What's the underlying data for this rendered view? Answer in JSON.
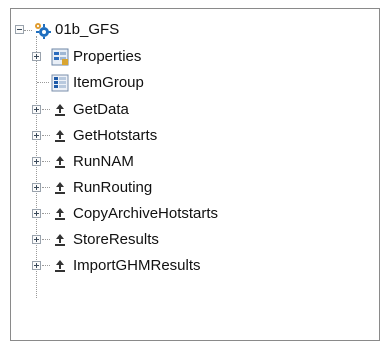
{
  "tree": {
    "root": {
      "label": "01b_GFS",
      "icon": "gear-cluster-icon",
      "expanded": true
    },
    "children": [
      {
        "label": "Properties",
        "icon": "properties-grid-icon",
        "expander": "plus"
      },
      {
        "label": "ItemGroup",
        "icon": "itemgroup-grid-icon",
        "expander": "none"
      },
      {
        "label": "GetData",
        "icon": "task-upload-icon",
        "expander": "plus"
      },
      {
        "label": "GetHotstarts",
        "icon": "task-upload-icon",
        "expander": "plus"
      },
      {
        "label": "RunNAM",
        "icon": "task-upload-icon",
        "expander": "plus"
      },
      {
        "label": "RunRouting",
        "icon": "task-upload-icon",
        "expander": "plus"
      },
      {
        "label": "CopyArchiveHotstarts",
        "icon": "task-upload-icon",
        "expander": "plus"
      },
      {
        "label": "StoreResults",
        "icon": "task-upload-icon",
        "expander": "plus"
      },
      {
        "label": "ImportGHMResults",
        "icon": "task-upload-icon",
        "expander": "plus"
      }
    ]
  }
}
